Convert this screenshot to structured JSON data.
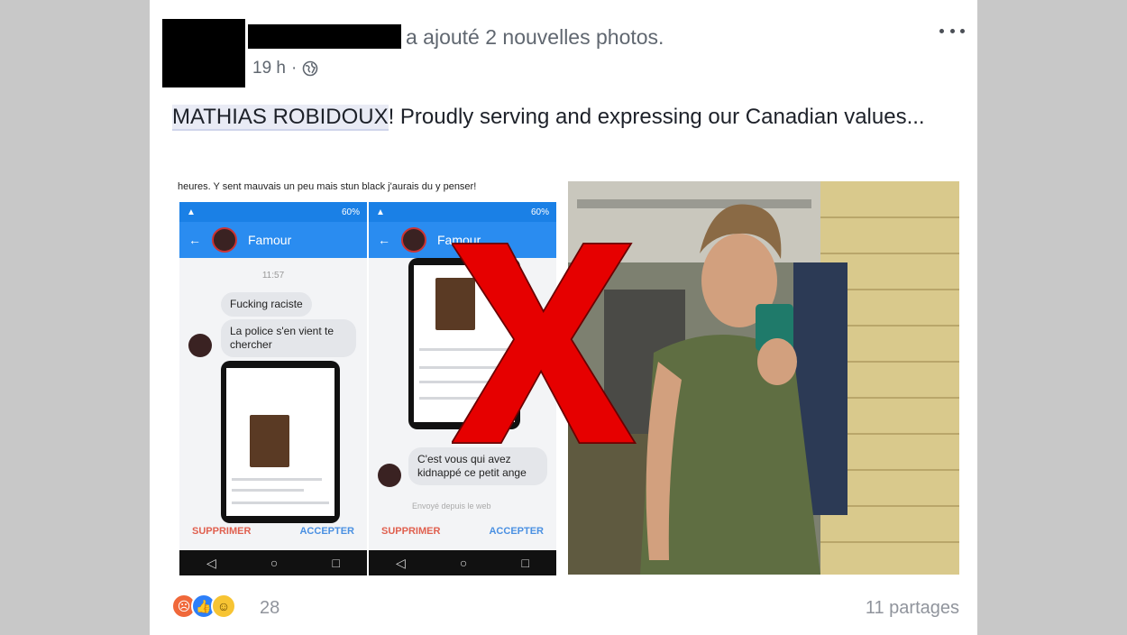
{
  "post": {
    "action_text": "a ajouté 2 nouvelles photos.",
    "timestamp": "19 h",
    "separator": "·",
    "mention": "MATHIAS ROBIDOUX",
    "text_rest": "! Proudly serving and expressing our Canadian values..."
  },
  "screenshot": {
    "header_text": "heures. Y sent mauvais un peu mais stun black j'aurais du y penser!",
    "contact_name": "Famour",
    "time": "11:57",
    "messages_left": [
      "Fucking raciste",
      "La police s'en vient te chercher"
    ],
    "message_right": "C'est vous qui avez kidnappé ce petit ange",
    "seen_text": "Envoyé depuis le web",
    "delete_label": "SUPPRIMER",
    "accept_label": "ACCEPTER",
    "status_battery": "60%"
  },
  "footer": {
    "reaction_count": "28",
    "shares": "11 partages"
  },
  "colors": {
    "cross": "#e60000",
    "messenger_blue": "#2a8cf0",
    "meta_gray": "#606770"
  },
  "icons": [
    "globe-icon",
    "more-options-icon",
    "angry-reaction-icon",
    "like-reaction-icon",
    "haha-reaction-icon",
    "back-arrow-icon",
    "x-cross-icon"
  ]
}
